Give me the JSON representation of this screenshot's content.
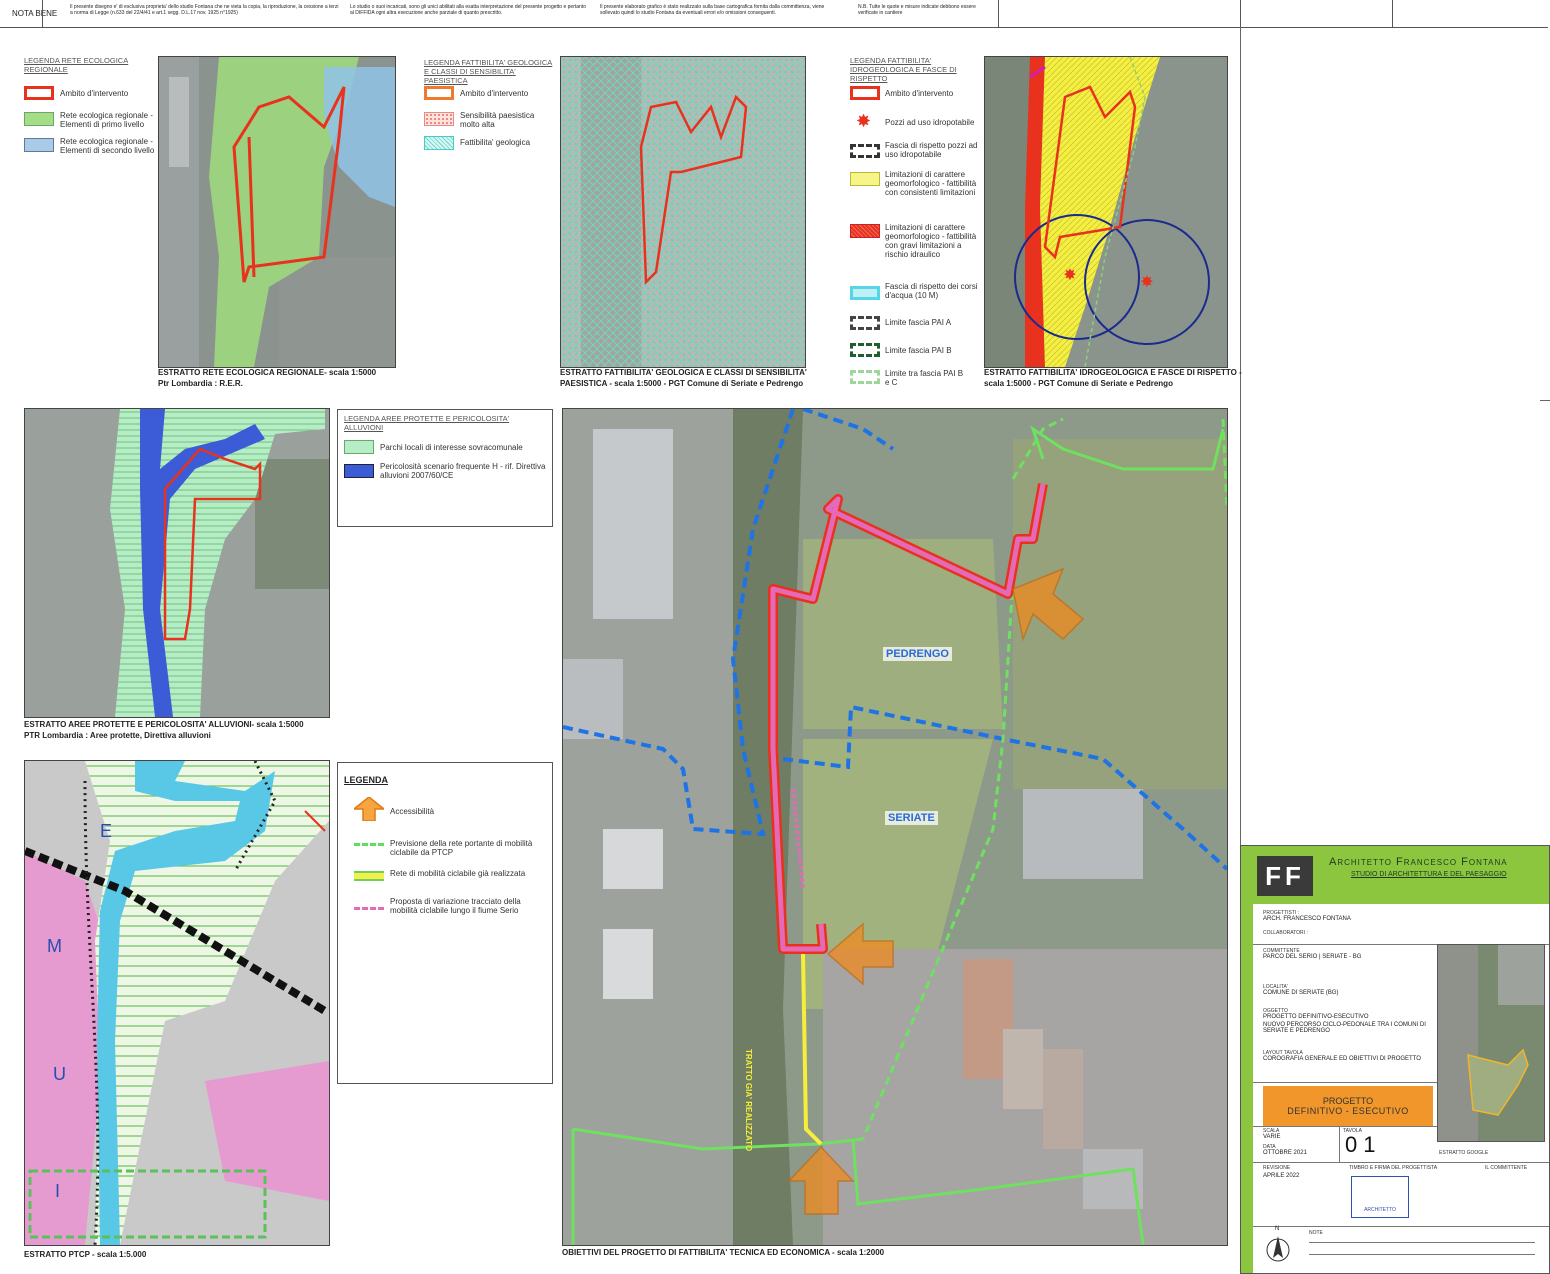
{
  "header": {
    "nota_bene": "NOTA BENE",
    "notes": [
      "Il presente disegno e' di esclusiva proprieta' dello studio Fontana che ne vieta la copia, la riproduzione, la cessione a terzi a norma di Legge (n.633 del 22/4/41 e art.1 segg. D.L.17 nov. 1925 n°1925)",
      "Lo studio o suoi incaricati, sono gli unici abilitati alla esatta interpretazione del presente progetto e pertanto al DIFFIDA ogni altra esecuzione anche parziale di quanto prescritto.",
      "Il presente elaborato grafico è stato realizzato sulla base cartografica fornita dalla committenza, viene sollevato quindi lo studio Fontana da eventuali errori e/o omissioni conseguenti.",
      "N.B. Tutte le quote e misure indicate debbono essere verificate in cantiere"
    ]
  },
  "panel_rer": {
    "legend_title": "LEGENDA RETE ECOLOGICA REGIONALE",
    "items": [
      "Ambito d'intervento",
      "Rete ecologica regionale - Elementi di primo livello",
      "Rete ecologica regionale - Elementi di secondo livello"
    ],
    "caption1": "ESTRATTO RETE ECOLOGICA REGIONALE- scala 1:5000",
    "caption2": "Ptr Lombardia : R.E.R."
  },
  "panel_geo": {
    "legend_title": "LEGENDA FATTIBILITA' GEOLOGICA E CLASSI DI SENSIBILITA' PAESISTICA",
    "items": [
      "Ambito d'intervento",
      "Sensibilità paesistica molto alta",
      "Fattibilita' geologica"
    ],
    "caption1": "ESTRATTO FATTIBILITA' GEOLOGICA E CLASSI DI SENSIBILITA'",
    "caption2": "PAESISTICA - scala 1:5000 - PGT Comune di Seriate e Pedrengo"
  },
  "panel_idro": {
    "legend_title": "LEGENDA FATTIBILITA' IDROGEOLOGICA E FASCE DI RISPETTO",
    "items": [
      "Ambito d'intervento",
      "Pozzi ad uso idropotabile",
      "Fascia di rispetto pozzi ad uso idropotabile",
      "Limitazioni di carattere geomorfologico - fattibilità con consistenti limitazioni",
      "Limitazioni di carattere geomorfologico - fattibilità con gravi limitazioni a rischio idraulico",
      "Fascia di rispetto dei corsi d'acqua (10 M)",
      "Limite fascia PAI A",
      "Limite fascia PAI B",
      "Limite tra fascia PAI B e C"
    ],
    "caption1": "ESTRATTO FATTIBILITA' IDROGEOLOGICA E FASCE DI RISPETTO -",
    "caption2": "scala 1:5000 - PGT Comune di Seriate e Pedrengo"
  },
  "panel_aree": {
    "legend_title": "LEGENDA AREE PROTETTE E PERICOLOSITA' ALLUVIONI",
    "items": [
      "Parchi locali di interesse sovracomunale",
      "Pericolosità scenario frequente H - rif. Direttiva alluvioni 2007/60/CE"
    ],
    "caption1": "ESTRATTO AREE PROTETTE E PERICOLOSITA' ALLUVIONI- scala 1:5000",
    "caption2": "PTR Lombardia : Aree protette, Direttiva alluvioni"
  },
  "panel_ptcp": {
    "legend_title": "LEGENDA",
    "items": [
      "Accessibilità",
      "Previsione della rete portante di mobilità ciclabile da PTCP",
      "Rete di mobilità ciclabile già realizzata",
      "Proposta di variazione tracciato della mobilità ciclabile lungo il fiume Serio"
    ],
    "map_letters": [
      "E",
      "M",
      "U",
      "I"
    ],
    "caption": "ESTRATTO PTCP - scala 1:5.000"
  },
  "main_map": {
    "labels": [
      "PEDRENGO",
      "SERIATE"
    ],
    "path_label": "TRATTO GIA' REALIZZATO",
    "caption": "OBIETTIVI DEL PROGETTO DI FATTIBILITA' TECNICA ED ECONOMICA - scala 1:2000"
  },
  "title_block": {
    "logo": "FF",
    "studio_name": "Architetto Francesco Fontana",
    "studio_sub": "STUDIO DI ARCHITETTURA E DEL PAESAGGIO",
    "progettisti_lbl": "PROGETTISTI :",
    "progettisti": "ARCH. FRANCESCO FONTANA",
    "collaboratori_lbl": "COLLABORATORI :",
    "committente_lbl": "COMMITTENTE",
    "committente": "PARCO DEL SERIO | SERIATE - BG",
    "localita_lbl": "LOCALITA'",
    "localita": "COMUNE DI SERIATE (BG)",
    "oggetto_lbl": "OGGETTO",
    "oggetto1": "PROGETTO DEFINITIVO-ESECUTIVO",
    "oggetto2": "NUOVO PERCORSO CICLO-PEDONALE TRA I COMUNI DI SERIATE E PEDRENGO",
    "layout_lbl": "LAYOUT TAVOLA",
    "layout": "COROGRAFIA GENERALE ED OBIETTIVI DI PROGETTO",
    "phase1": "PROGETTO",
    "phase2": "DEFINITIVO - ESECUTIVO",
    "scala_lbl": "SCALA",
    "scala": "VARIE",
    "data_lbl": "DATA",
    "data": "OTTOBRE 2021",
    "tavola_lbl": "TAVOLA",
    "tavola": "01",
    "revisione_lbl": "REVISIONE",
    "revisione": "APRILE 2022",
    "timbro_lbl": "TIMBRO E FIRMA DEL PROGETTISTA",
    "committente2_lbl": "IL COMMITTENTE",
    "estratto_lbl": "ESTRATTO GOOGLE",
    "stamp": "ARCHITETTO",
    "note_lbl": "NOTE",
    "north": "N"
  },
  "colors": {
    "red": "#e8321e",
    "green_rer": "#8fd36a",
    "blue_rer": "#8fc3e6",
    "orange": "#f08a1e",
    "teal": "#4fd3c6",
    "yellow": "#f3f04a",
    "pink": "#e46ab8",
    "darkblue": "#1a2a8f",
    "title_orange": "#f0962a",
    "title_green": "#8cc63f"
  }
}
